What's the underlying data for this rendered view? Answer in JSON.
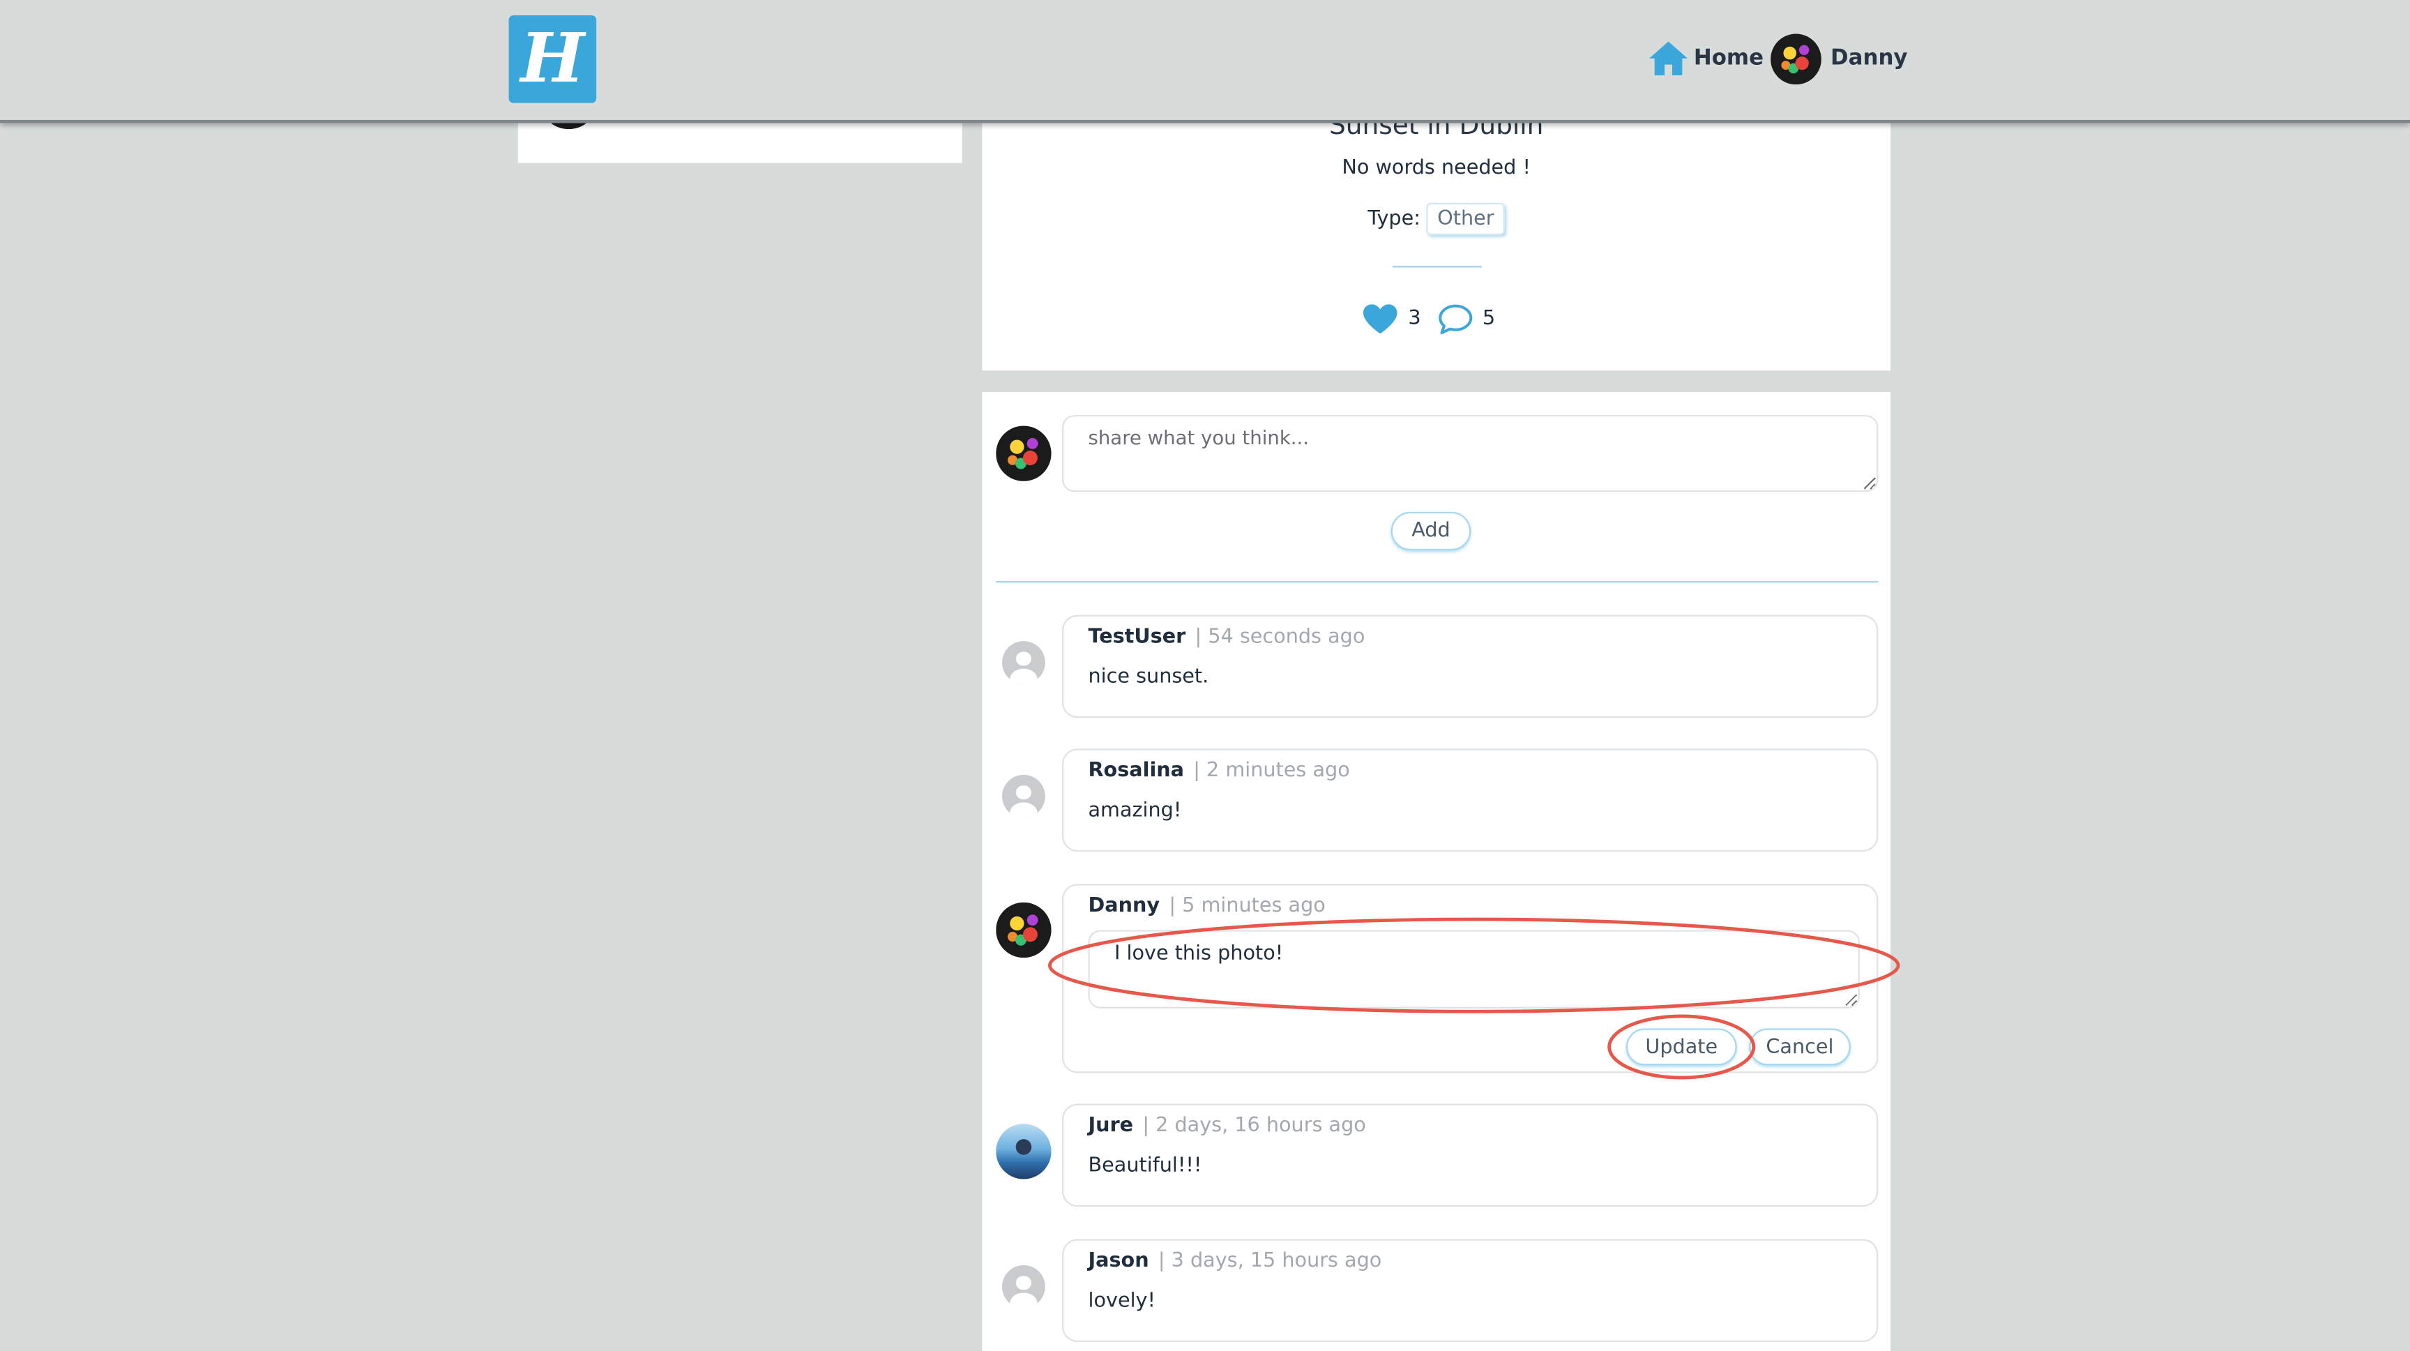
{
  "navbar": {
    "logo_letter": "H",
    "home_label": "Home",
    "user_name": "Danny",
    "accent_color": "#3ba6da"
  },
  "post": {
    "title": "Sunset in Dublin",
    "description": "No words needed !",
    "type_label": "Type:",
    "type_value": "Other",
    "likes": "3",
    "comments": "5"
  },
  "new_comment": {
    "placeholder": "share what you think...",
    "add_label": "Add"
  },
  "comments": [
    {
      "author": "TestUser",
      "time": "| 54 seconds ago",
      "text": "nice sunset.",
      "avatar": "default-avatar"
    },
    {
      "author": "Rosalina",
      "time": "| 2 minutes ago",
      "text": "amazing!",
      "avatar": "default-avatar"
    },
    {
      "author": "Danny",
      "time": "| 5 minutes ago",
      "text": "I love this photo!",
      "avatar": "user-photo-avatar",
      "editing": true,
      "update_label": "Update",
      "cancel_label": "Cancel"
    },
    {
      "author": "Jure",
      "time": "| 2 days, 16 hours ago",
      "text": "Beautiful!!!",
      "avatar": "user-photo-avatar"
    },
    {
      "author": "Jason",
      "time": "| 3 days, 15 hours ago",
      "text": "lovely!",
      "avatar": "default-avatar"
    }
  ],
  "icons": {
    "home": "home-icon",
    "like": "heart-icon",
    "comment": "speech-bubble-icon",
    "annotation_color": "#e8584a"
  }
}
